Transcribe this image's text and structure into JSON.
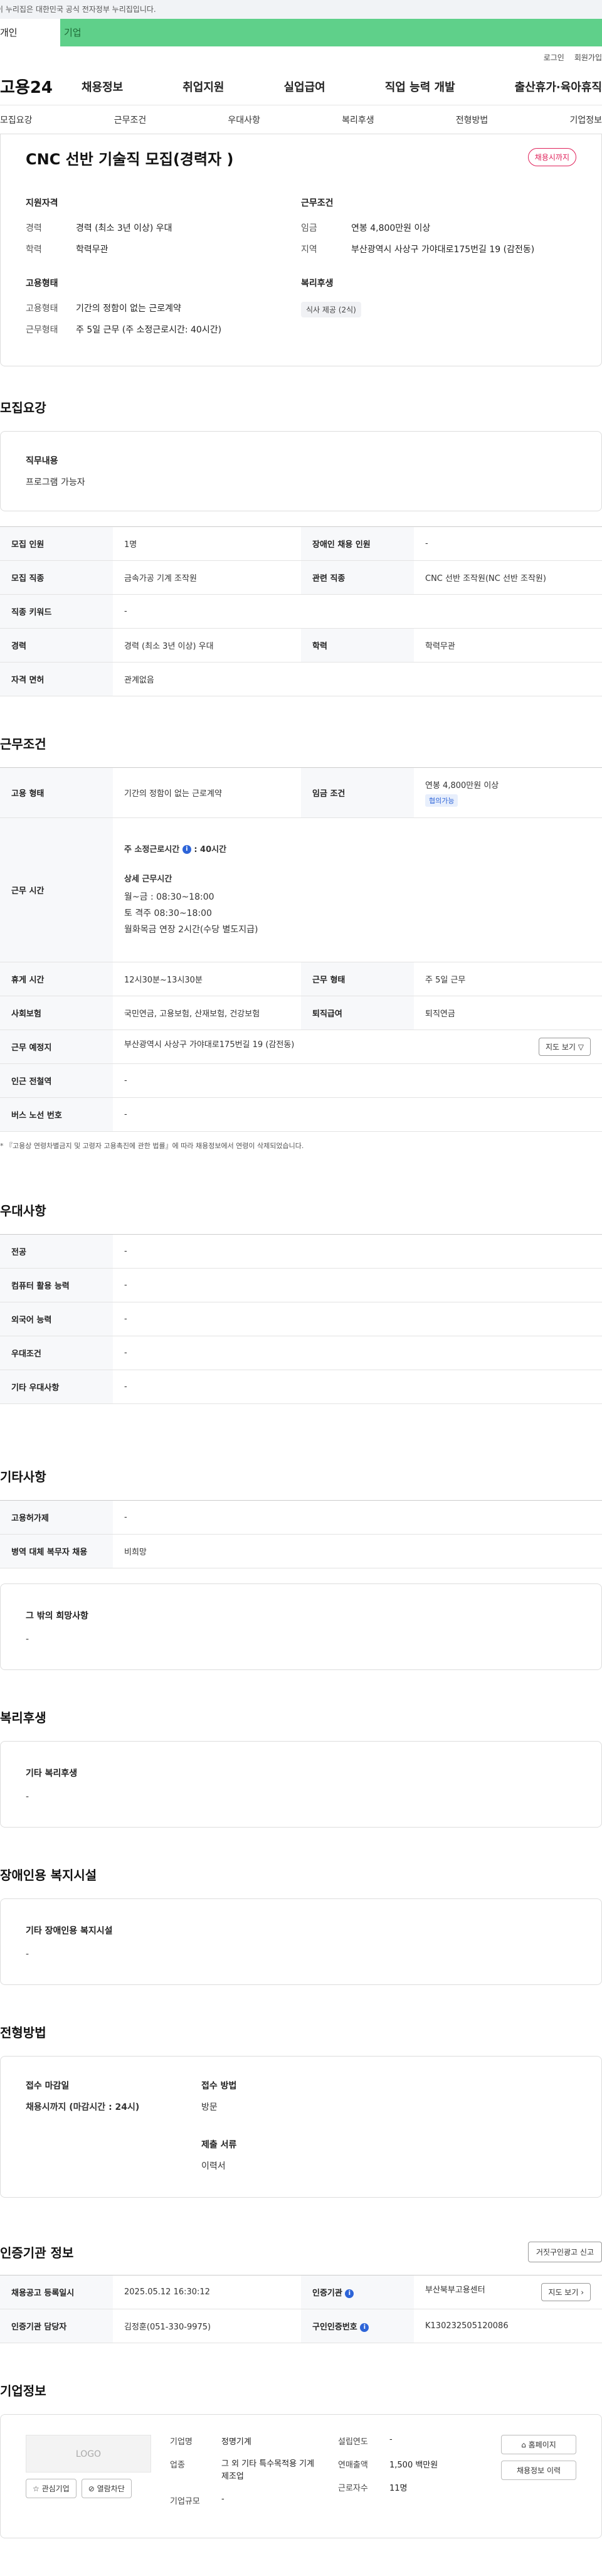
{
  "gov_strip": "이 누리집은 대한민국 공식 전자정부 누리집입니다.",
  "user_tabs": {
    "personal": "개인",
    "company": "기업"
  },
  "util": {
    "login": "로그인",
    "signup": "회원가입"
  },
  "logo": "고용24",
  "gnb": [
    "채용정보",
    "취업지원",
    "실업급여",
    "직업 능력 개발",
    "출산휴가·육아휴직"
  ],
  "tabs": [
    "모집요강",
    "근무조건",
    "우대사항",
    "복리후생",
    "전형방법",
    "기업정보"
  ],
  "summary": {
    "title": "CNC 선반 기술직 모집(경력자 )",
    "status": "채용시까지",
    "qual_title": "지원자격",
    "qual": [
      {
        "k": "경력",
        "v": "경력 (최소 3년 이상) 우대"
      },
      {
        "k": "학력",
        "v": "학력무관"
      }
    ],
    "emp_title": "고용형태",
    "emp": [
      {
        "k": "고용형태",
        "v": "기간의 정함이 없는 근로계약"
      },
      {
        "k": "근무형태",
        "v": "주 5일 근무 (주 소정근로시간: 40시간)"
      }
    ],
    "work_title": "근무조건",
    "work": [
      {
        "k": "임금",
        "v": "연봉 4,800만원 이상"
      },
      {
        "k": "지역",
        "v": "부산광역시 사상구 가야대로175번길 19 (감전동)"
      }
    ],
    "welfare_title": "복리후생",
    "welfare_chip": "식사 제공 (2식)"
  },
  "recruit": {
    "heading": "모집요강",
    "duty_title": "직무내용",
    "duty_text": "프로그램 가능자",
    "rows": [
      [
        "모집 인원",
        "1명",
        "장애인 채용 인원",
        "-"
      ],
      [
        "모집 직종",
        "금속가공 기계 조작원",
        "관련 직종",
        "CNC 선반 조작원(NC 선반 조작원)"
      ],
      [
        "직종 키워드",
        "-"
      ],
      [
        "경력",
        "경력 (최소 3년 이상) 우대",
        "학력",
        "학력무관"
      ],
      [
        "자격 면허",
        "관계없음"
      ]
    ]
  },
  "conditions": {
    "heading": "근무조건",
    "emp_type_k": "고용 형태",
    "emp_type_v": "기간의 정함이 없는 근로계약",
    "wage_k": "임금 조건",
    "wage_v": "연봉 4,800만원 이상",
    "wage_chip": "협의가능",
    "hours_k": "근무 시간",
    "hours_weekly": "주 소정근로시간",
    "hours_weekly_v": ": 40시간",
    "hours_detail_title": "상세 근무시간",
    "hours_lines": [
      "월~금 : 08:30~18:00",
      "토 격주 08:30~18:00",
      "월화목금 연장 2시간(수당 별도지급)"
    ],
    "break_k": "휴게 시간",
    "break_v": "12시30분~13시30분",
    "worktype_k": "근무 형태",
    "worktype_v": "주 5일 근무",
    "insurance_k": "사회보험",
    "insurance_v": "국민연금, 고용보험, 산재보험, 건강보험",
    "retire_k": "퇴직급여",
    "retire_v": "퇴직연금",
    "location_k": "근무 예정지",
    "location_v": "부산광역시 사상구 가야대로175번길 19 (감전동)",
    "map_btn": "지도 보기 ▽",
    "station_k": "인근 전철역",
    "station_v": "-",
    "bus_k": "버스 노선 번호",
    "bus_v": "-",
    "note": "* 『고용상 연령차별금지 및 고령자 고용촉진에 관한 법률』에 따라 채용정보에서 연령이 삭제되었습니다."
  },
  "pref": {
    "heading": "우대사항",
    "rows": [
      [
        "전공",
        "-"
      ],
      [
        "컴퓨터 활용 능력",
        "-"
      ],
      [
        "외국어 능력",
        "-"
      ],
      [
        "우대조건",
        "-"
      ],
      [
        "기타 우대사항",
        "-"
      ]
    ]
  },
  "etc": {
    "heading": "기타사항",
    "rows": [
      [
        "고용허가제",
        "-"
      ],
      [
        "병역 대체 복무자 채용",
        "비희망"
      ]
    ],
    "other_title": "그 밖의 희망사항",
    "other_text": "-"
  },
  "welfare": {
    "heading": "복리후생",
    "title": "기타 복리후생",
    "text": "-"
  },
  "disabled": {
    "heading": "장애인용 복지시설",
    "title": "기타 장애인용 복지시설",
    "text": "-"
  },
  "apply": {
    "heading": "전형방법",
    "deadline_title": "접수 마감일",
    "deadline_v": "채용시까지 (마감시간 : 24시)",
    "method_title": "접수 방법",
    "method_v": "방문",
    "docs_title": "제출 서류",
    "docs_v": "이력서"
  },
  "cert": {
    "heading": "인증기관 정보",
    "report_btn": "거짓구인광고 신고",
    "reg_k": "채용공고 등록일시",
    "reg_v": "2025.05.12 16:30:12",
    "org_k": "인증기관",
    "org_v": "부산북부고용센터",
    "map_btn": "지도 보기 ›",
    "mgr_k": "인증기관 담당자",
    "mgr_v": "김정훈(051-330-9975)",
    "no_k": "구인인증번호",
    "no_v": "K130232505120086"
  },
  "company": {
    "heading": "기업정보",
    "logo": "LOGO",
    "fav_btn": "☆ 관심기업",
    "block_btn": "⊘ 열람차단",
    "col1": [
      {
        "k": "기업명",
        "v": "정명기계"
      },
      {
        "k": "업종",
        "v": "그 외 기타 특수목적용 기계 제조업"
      },
      {
        "k": "기업규모",
        "v": "-"
      }
    ],
    "col2": [
      {
        "k": "설립연도",
        "v": "-"
      },
      {
        "k": "연매출액",
        "v": "1,500 백만원"
      },
      {
        "k": "근로자수",
        "v": "11명"
      }
    ],
    "home_btn": "⌂ 홈페이지",
    "history_btn": "채용정보 이력"
  }
}
